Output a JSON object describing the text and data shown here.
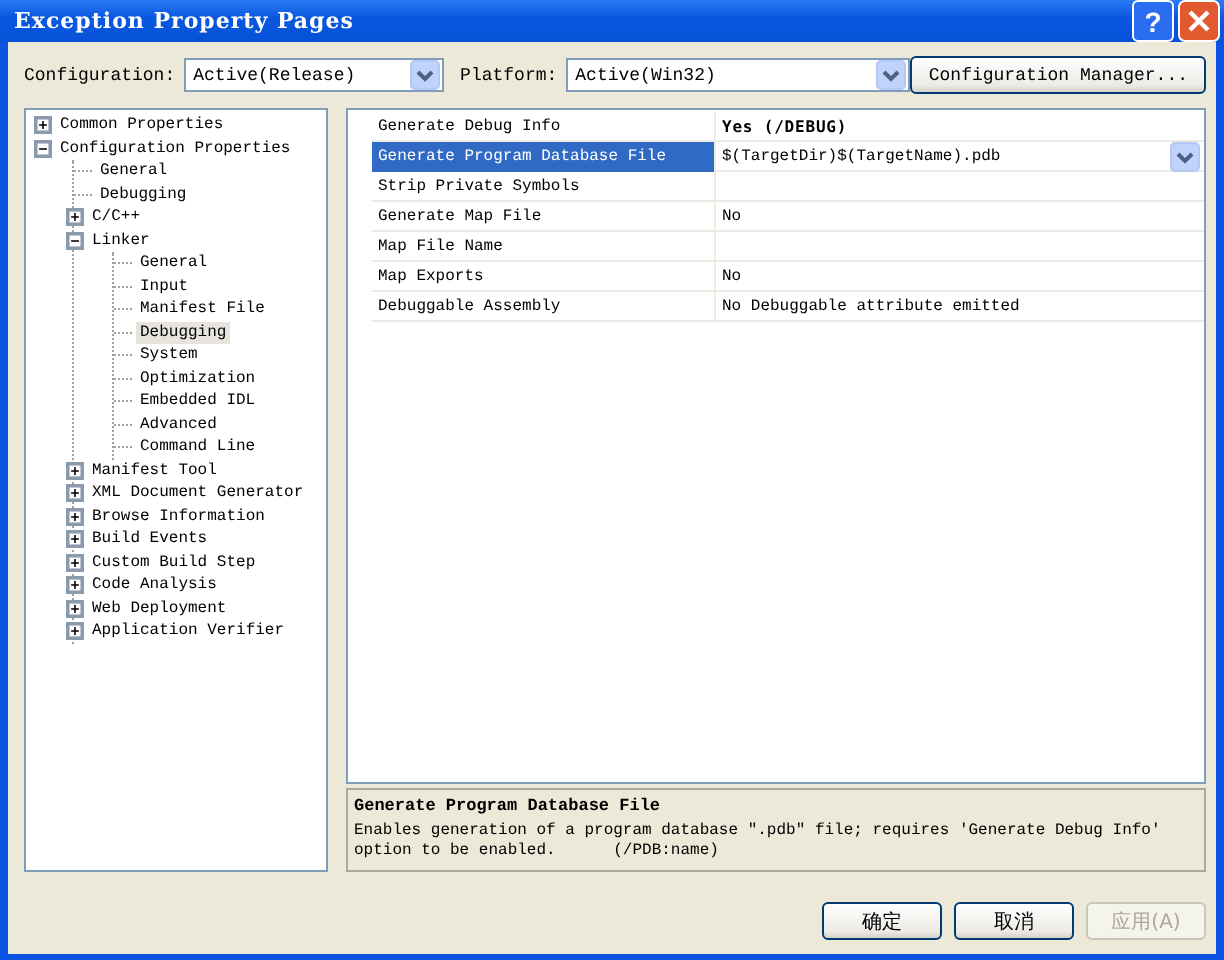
{
  "window": {
    "title": "Exception Property Pages",
    "help_button": "?"
  },
  "configuration": {
    "label": "Configuration:",
    "value": "Active(Release)"
  },
  "platform": {
    "label": "Platform:",
    "value": "Active(Win32)"
  },
  "configuration_manager_button": "Configuration Manager...",
  "tree": [
    {
      "label": "Common Properties",
      "expanded": false,
      "selected": false
    },
    {
      "label": "Configuration Properties",
      "expanded": true,
      "selected": false,
      "children": [
        {
          "label": "General",
          "selected": false
        },
        {
          "label": "Debugging",
          "selected": false
        },
        {
          "label": "C/C++",
          "expanded": false,
          "selected": false
        },
        {
          "label": "Linker",
          "expanded": true,
          "selected": false,
          "children": [
            {
              "label": "General",
              "selected": false
            },
            {
              "label": "Input",
              "selected": false
            },
            {
              "label": "Manifest File",
              "selected": false
            },
            {
              "label": "Debugging",
              "selected": true
            },
            {
              "label": "System",
              "selected": false
            },
            {
              "label": "Optimization",
              "selected": false
            },
            {
              "label": "Embedded IDL",
              "selected": false
            },
            {
              "label": "Advanced",
              "selected": false
            },
            {
              "label": "Command Line",
              "selected": false
            }
          ]
        },
        {
          "label": "Manifest Tool",
          "expanded": false,
          "selected": false
        },
        {
          "label": "XML Document Generator",
          "expanded": false,
          "selected": false
        },
        {
          "label": "Browse Information",
          "expanded": false,
          "selected": false
        },
        {
          "label": "Build Events",
          "expanded": false,
          "selected": false
        },
        {
          "label": "Custom Build Step",
          "expanded": false,
          "selected": false
        },
        {
          "label": "Code Analysis",
          "expanded": false,
          "selected": false
        },
        {
          "label": "Web Deployment",
          "expanded": false,
          "selected": false
        },
        {
          "label": "Application Verifier",
          "expanded": false,
          "selected": false
        }
      ]
    }
  ],
  "properties": [
    {
      "name": "Generate Debug Info",
      "value": "Yes (/DEBUG)",
      "modified": true,
      "selected": false
    },
    {
      "name": "Generate Program Database File",
      "value": "$(TargetDir)$(TargetName).pdb",
      "modified": false,
      "selected": true
    },
    {
      "name": "Strip Private Symbols",
      "selected": false
    },
    {
      "name": "Generate Map File",
      "value": "No",
      "modified": false,
      "selected": false
    },
    {
      "name": "Map File Name",
      "selected": false
    },
    {
      "name": "Map Exports",
      "value": "No",
      "modified": false,
      "selected": false
    },
    {
      "name": "Debuggable Assembly",
      "value": "No Debuggable attribute emitted",
      "modified": false,
      "selected": false
    }
  ],
  "description": {
    "title": "Generate Program Database File",
    "text": "Enables generation of a program database \".pdb\" file; requires 'Generate Debug Info' option to be enabled.      (/PDB:name)"
  },
  "buttons": [
    {
      "label": "确定",
      "disabled": false
    },
    {
      "label": "取消",
      "disabled": false
    },
    {
      "label": "应用(A)",
      "disabled": true
    }
  ]
}
